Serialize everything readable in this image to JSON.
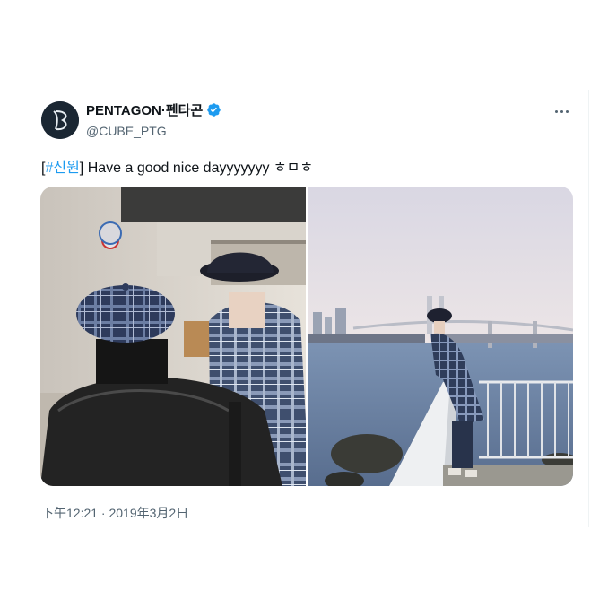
{
  "tweet": {
    "display_name": "PENTAGON·펜타곤",
    "handle": "@CUBE_PTG",
    "text_open": "[",
    "hashtag": "#신원",
    "text_rest": "] Have a good nice dayyyyyyy ㅎㅁㅎ",
    "timestamp": "下午12:21 · 2019年3月2日",
    "verified": true,
    "media_count": 2
  },
  "icons": {
    "avatar": "pentagon-logo",
    "verified": "verified-badge-icon",
    "more": "more-options-icon"
  },
  "colors": {
    "accent": "#1d9bf0",
    "text": "#0f1419",
    "secondary": "#536471"
  }
}
